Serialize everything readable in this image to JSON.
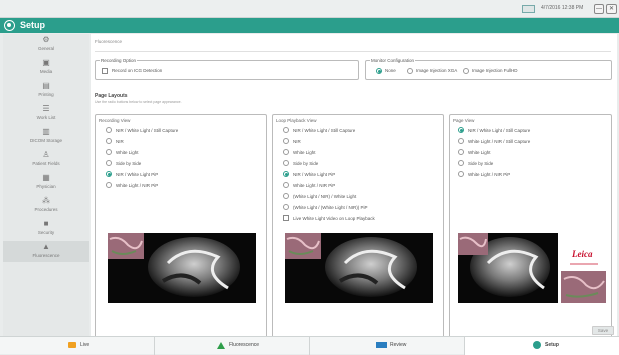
{
  "topbar": {
    "datetime": "4/7/2016  12:38 PM",
    "minimize": "—",
    "close": "✕"
  },
  "titlebar": {
    "title": "Setup"
  },
  "sidebar": {
    "items": [
      {
        "label": "General",
        "icon": "gear-icon"
      },
      {
        "label": "Media",
        "icon": "media-icon"
      },
      {
        "label": "Printing",
        "icon": "printer-icon"
      },
      {
        "label": "Work List",
        "icon": "list-icon"
      },
      {
        "label": "DICOM Storage",
        "icon": "storage-icon"
      },
      {
        "label": "Patient Fields",
        "icon": "patient-icon"
      },
      {
        "label": "Physician",
        "icon": "physician-icon"
      },
      {
        "label": "Procedures",
        "icon": "procedures-icon"
      },
      {
        "label": "Security",
        "icon": "lock-icon"
      },
      {
        "label": "Fluorescence",
        "icon": "flask-icon"
      }
    ],
    "active": "Fluorescence"
  },
  "main": {
    "breadcrumb": "Fluorescence",
    "recording_option": {
      "legend": "Recording Option",
      "checkbox_label": "Record on ICG Detection"
    },
    "monitor_configuration": {
      "legend": "Monitor Configuration",
      "options": [
        "None",
        "Image Injection XGA",
        "Image Injection FullHD"
      ],
      "selected": "None"
    },
    "page_layouts": {
      "title": "Page Layouts",
      "subtitle": "Use the radio buttons below to select page appearance."
    },
    "recording_view": {
      "title": "Recording View",
      "options": [
        "NIR / White Light / Still Capture",
        "NIR",
        "White Light",
        "Side by Side",
        "NIR / White Light PiP",
        "White Light / NIR PiP"
      ],
      "selected": "NIR / White Light PiP"
    },
    "loop_playback_view": {
      "title": "Loop Playback View",
      "options": [
        "NIR / White Light / Still Capture",
        "NIR",
        "White Light",
        "Side by Side",
        "NIR / White Light PiP",
        "White Light / NIR PiP",
        "(White Light / NIR) / White Light",
        "(White Light / (White Light / NIR)) PiP"
      ],
      "selected": "NIR / White Light PiP",
      "checkbox_label": "Live White Light Video on Loop Playback"
    },
    "page_view": {
      "title": "Page View",
      "options": [
        "NIR / White Light / Still Capture",
        "White Light / NIR / Still Capture",
        "White Light",
        "Side by Side",
        "White Light / NIR PiP"
      ],
      "selected": "NIR / White Light / Still Capture",
      "brand": "Leica"
    },
    "save_label": "Save"
  },
  "footer": {
    "tabs": [
      "Live",
      "Fluorescence",
      "Review",
      "Setup"
    ],
    "active": "Setup"
  },
  "colors": {
    "accent": "#2b9e8c",
    "live": "#f0a020",
    "fluorescence": "#2e9e4a",
    "review": "#2a7ec0"
  }
}
